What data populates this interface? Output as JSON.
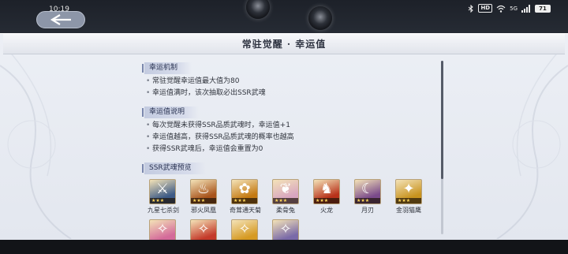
{
  "status": {
    "time": "10:19",
    "network_badge": "HD",
    "signal_label": "5G",
    "battery": "71"
  },
  "panel": {
    "title": "常驻觉醒 · 幸运值"
  },
  "sections": [
    {
      "heading": "幸运机制",
      "bullets": [
        "常驻觉醒幸运值最大值为80",
        "幸运值满时，该次抽取必出SSR武魂"
      ]
    },
    {
      "heading": "幸运值说明",
      "bullets": [
        "每次觉醒未获得SSR品质武魂时，幸运值+1",
        "幸运值越高，获得SSR品质武魂的概率也越高",
        "获得SSR武魂后，幸运值会重置为0"
      ]
    },
    {
      "heading": "SSR武魂预览",
      "bullets": []
    }
  ],
  "weapons_row1": [
    {
      "name": "九星七杀剑",
      "stars": "★★★",
      "color": "#3d5a86",
      "icon": "sword-icon"
    },
    {
      "name": "邪火凤凰",
      "stars": "★★★",
      "color": "#a8541c",
      "icon": "phoenix-icon"
    },
    {
      "name": "奇茸通天菊",
      "stars": "★★★",
      "color": "#c47a12",
      "icon": "flower-icon"
    },
    {
      "name": "柔骨兔",
      "stars": "★★★",
      "color": "#d8a6c0",
      "icon": "rabbit-icon"
    },
    {
      "name": "火龙",
      "stars": "★★★",
      "color": "#b8321a",
      "icon": "dragon-icon"
    },
    {
      "name": "月刃",
      "stars": "★★★",
      "color": "#7a4a8a",
      "icon": "moon-blade-icon"
    },
    {
      "name": "金羽猫鹰",
      "stars": "★★★",
      "color": "#c8931e",
      "icon": "owl-icon"
    }
  ],
  "weapons_row2": [
    {
      "color": "#d46a9a",
      "icon": "creature-icon"
    },
    {
      "color": "#c43a2a",
      "icon": "creature-icon"
    },
    {
      "color": "#d69a22",
      "icon": "creature-icon"
    },
    {
      "color": "#7a6aa8",
      "icon": "creature-icon"
    }
  ]
}
